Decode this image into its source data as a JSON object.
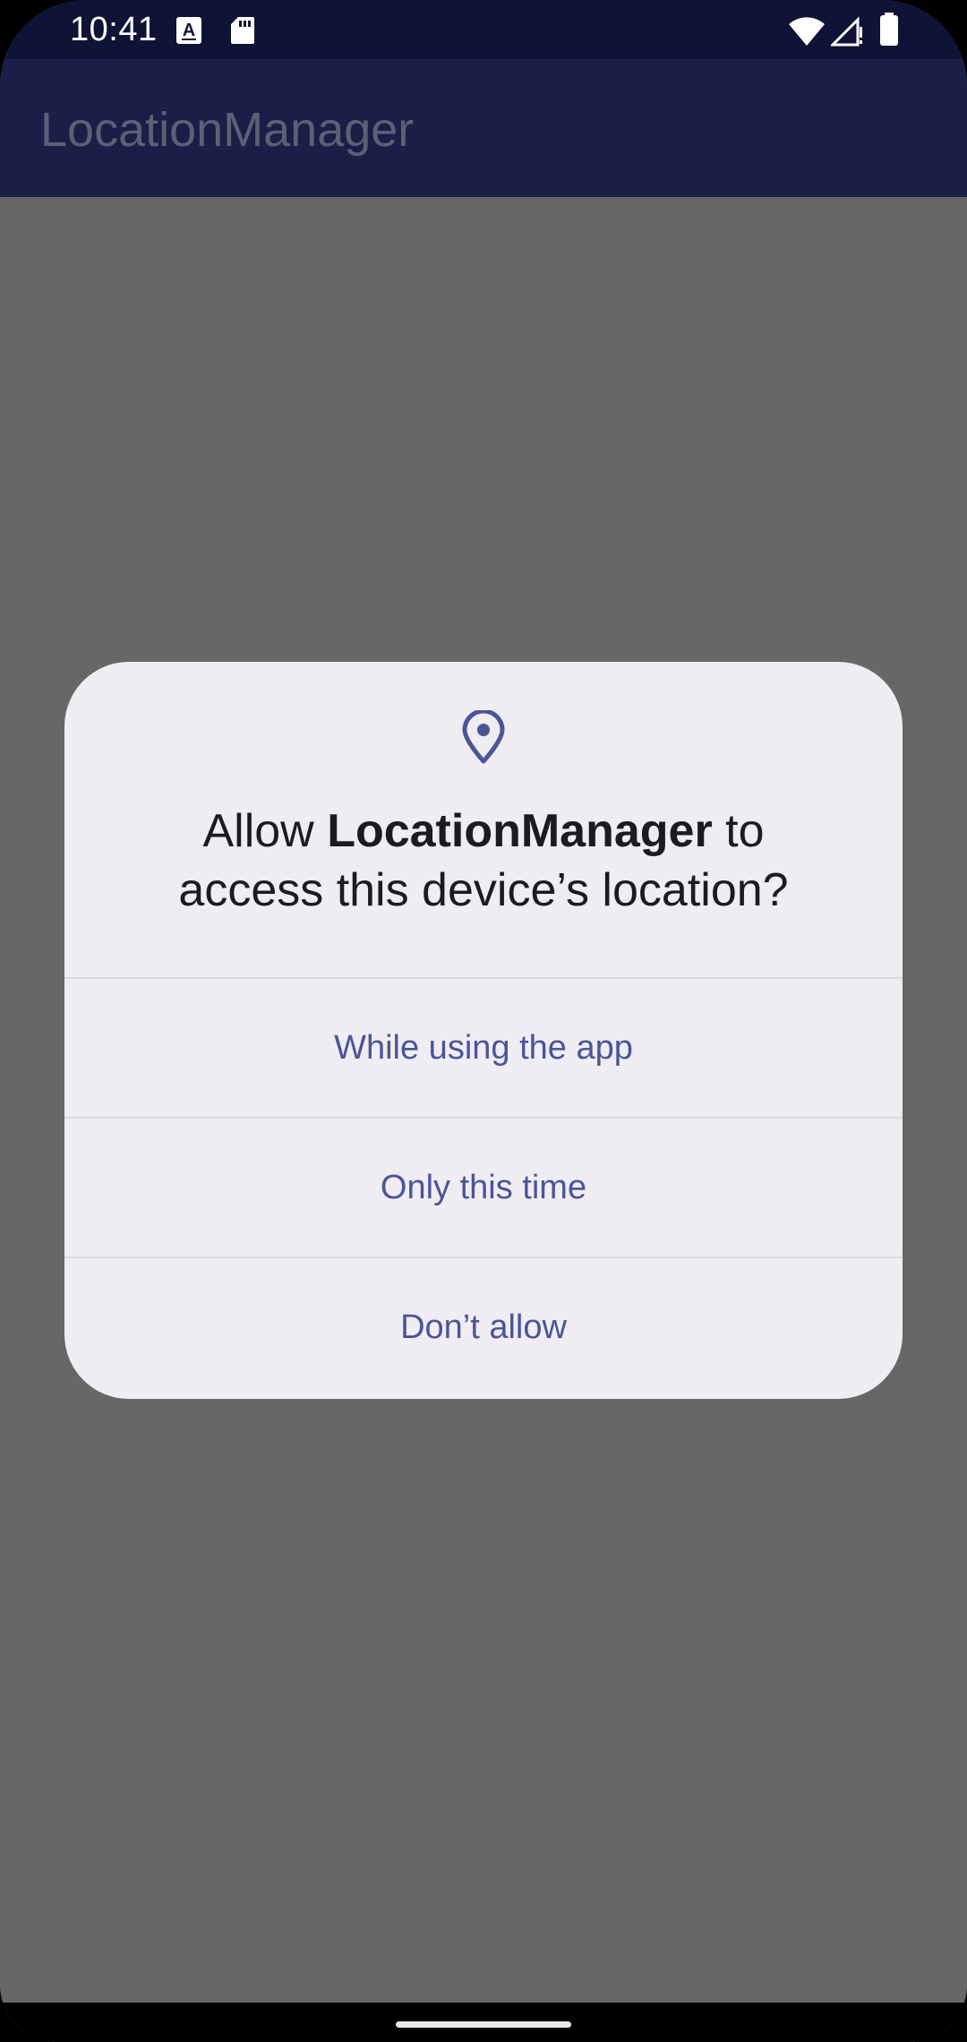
{
  "status_bar": {
    "time": "10:41",
    "left_icons": [
      "text-a-icon",
      "sd-card-icon"
    ],
    "right_icons": [
      "wifi-icon",
      "cellular-no-signal-icon",
      "battery-icon"
    ]
  },
  "app_bar": {
    "title": "LocationManager"
  },
  "permission_dialog": {
    "icon": "location-pin-icon",
    "title_prefix": "Allow ",
    "app_name": "LocationManager",
    "title_suffix": " to",
    "title_line2": "access this device’s location?",
    "options": [
      {
        "label": "While using the app"
      },
      {
        "label": "Only this time"
      },
      {
        "label": "Don’t allow"
      }
    ]
  },
  "colors": {
    "status_bar": "#0f1436",
    "app_bar": "#191f46",
    "scrim_background": "#676767",
    "dialog_surface": "#efedf2",
    "accent": "#4a5597"
  }
}
